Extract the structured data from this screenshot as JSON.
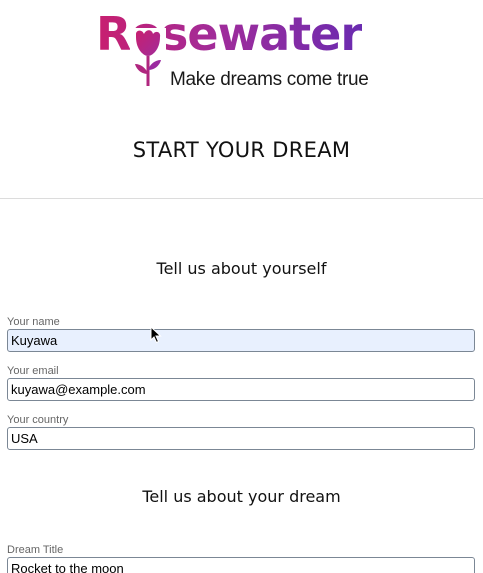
{
  "brand": {
    "name": "Rosewater",
    "tagline": "Make dreams come true"
  },
  "page": {
    "title": "START YOUR DREAM"
  },
  "sections": {
    "about_you": {
      "heading": "Tell us about yourself",
      "fields": {
        "name": {
          "label": "Your name",
          "value": "Kuyawa"
        },
        "email": {
          "label": "Your email",
          "value": "kuyawa@example.com"
        },
        "country": {
          "label": "Your country",
          "value": "USA"
        }
      }
    },
    "about_dream": {
      "heading": "Tell us about your dream",
      "fields": {
        "dream_title": {
          "label": "Dream Title",
          "value": "Rocket to the moon"
        }
      }
    }
  },
  "colors": {
    "brand_gradient_start": "#c81f6f",
    "brand_gradient_end": "#6a2bb0",
    "autofill_background": "#e8f0fe",
    "input_border": "#7b8795"
  },
  "icons": {
    "logo_rose": "rose-icon",
    "pointer": "mouse-cursor-icon"
  }
}
